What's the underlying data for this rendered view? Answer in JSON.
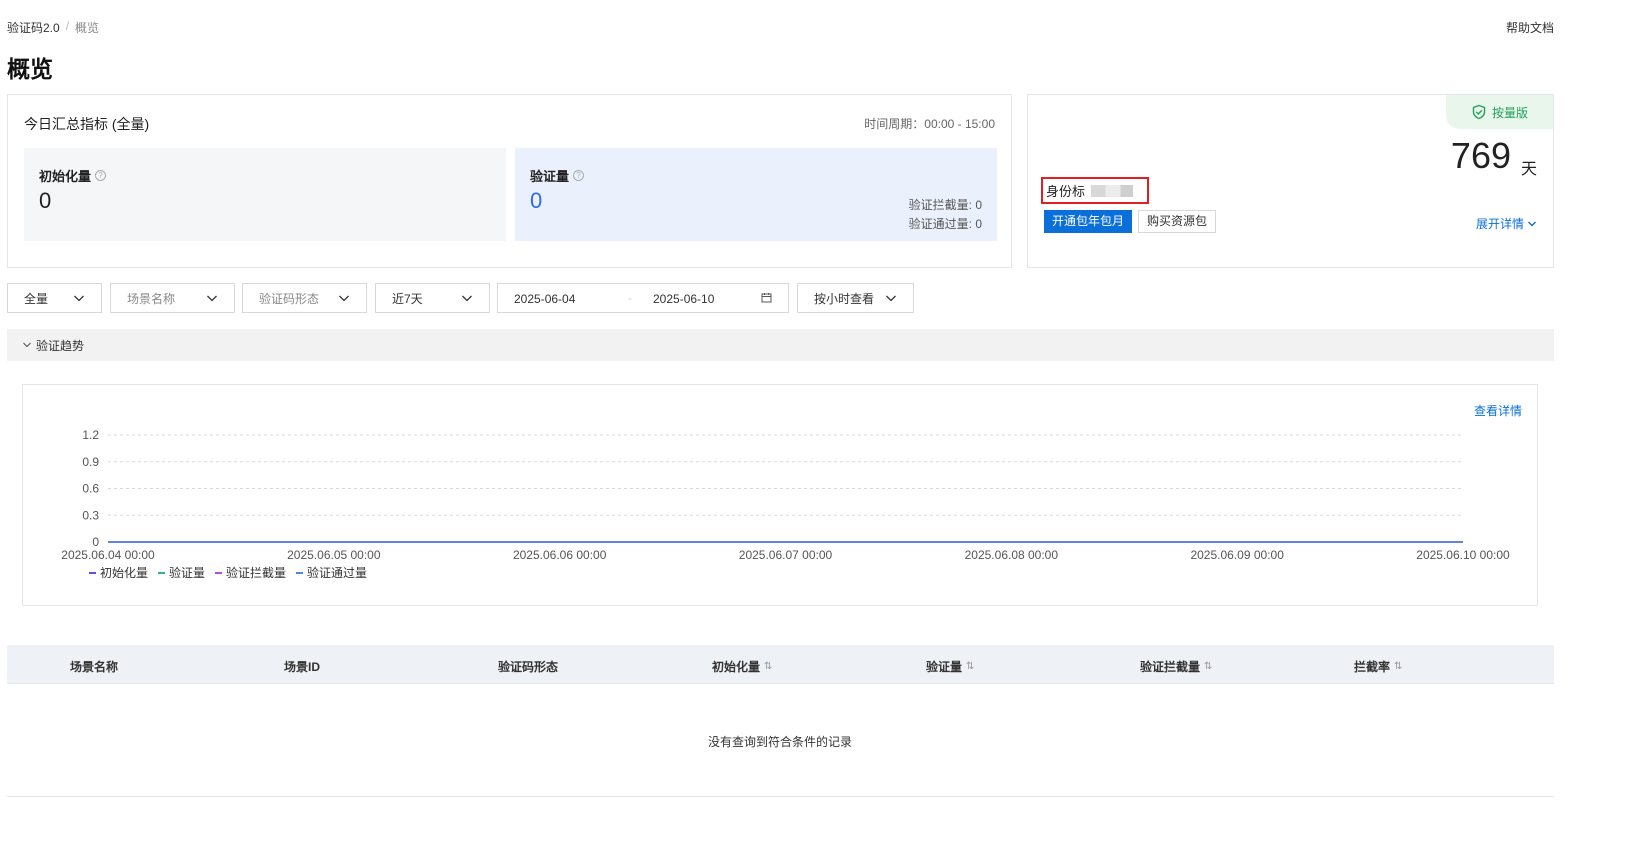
{
  "breadcrumb": {
    "parent": "验证码2.0",
    "separator": "/",
    "current": "概览"
  },
  "header": {
    "help_label": "帮助文档",
    "title": "概览"
  },
  "summary": {
    "title": "今日汇总指标 (全量)",
    "period": "时间周期：00:00 - 15:00",
    "init": {
      "label": "初始化量",
      "value": "0"
    },
    "verify": {
      "label": "验证量",
      "value": "0",
      "intercept": "验证拦截量: 0",
      "pass": "验证通过量: 0"
    }
  },
  "plan": {
    "badge": "按量版",
    "days": "769",
    "days_unit": "天",
    "identity_label": "身份标",
    "subscribe_button": "开通包年包月",
    "buy_button": "购买资源包",
    "expand_link": "展开详情"
  },
  "filters": {
    "scope": "全量",
    "scene_placeholder": "场景名称",
    "form_placeholder": "验证码形态",
    "range": "近7天",
    "start_date": "2025-06-04",
    "date_sep": "-",
    "end_date": "2025-06-10",
    "granularity": "按小时查看"
  },
  "trend_section": {
    "title": "验证趋势"
  },
  "chart": {
    "detail_link": "查看详情"
  },
  "chart_data": {
    "type": "line",
    "x": [
      "2025.06.04 00:00",
      "2025.06.05 00:00",
      "2025.06.06 00:00",
      "2025.06.07 00:00",
      "2025.06.08 00:00",
      "2025.06.09 00:00",
      "2025.06.10 00:00"
    ],
    "y_ticks": [
      1.2,
      0.9,
      0.6,
      0.3,
      0
    ],
    "ylim": [
      0,
      1.2
    ],
    "series": [
      {
        "name": "初始化量",
        "color": "#5b4fe0",
        "values": [
          0,
          0,
          0,
          0,
          0,
          0,
          0
        ]
      },
      {
        "name": "验证量",
        "color": "#2bb3a8",
        "values": [
          0,
          0,
          0,
          0,
          0,
          0,
          0
        ]
      },
      {
        "name": "验证拦截量",
        "color": "#b34fd9",
        "values": [
          0,
          0,
          0,
          0,
          0,
          0,
          0
        ]
      },
      {
        "name": "验证通过量",
        "color": "#4e86e4",
        "values": [
          0,
          0,
          0,
          0,
          0,
          0,
          0
        ]
      }
    ],
    "grid": true,
    "legend": "bottom-left"
  },
  "table": {
    "columns": [
      {
        "label": "场景名称",
        "sortable": false
      },
      {
        "label": "场景ID",
        "sortable": false
      },
      {
        "label": "验证码形态",
        "sortable": false
      },
      {
        "label": "初始化量",
        "sortable": true
      },
      {
        "label": "验证量",
        "sortable": true
      },
      {
        "label": "验证拦截量",
        "sortable": true
      },
      {
        "label": "拦截率",
        "sortable": true
      }
    ],
    "sort_glyph": "⇅",
    "empty_text": "没有查询到符合条件的记录"
  }
}
